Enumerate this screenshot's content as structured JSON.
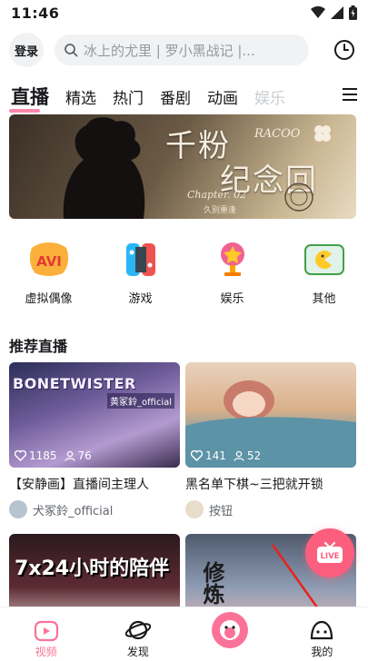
{
  "status": {
    "time": "11:46"
  },
  "header": {
    "login_label": "登录",
    "search_placeholder": "冰上的尤里 | 罗小黑战记 |..."
  },
  "tabs": [
    {
      "label": "直播",
      "active": true
    },
    {
      "label": "精选"
    },
    {
      "label": "热门"
    },
    {
      "label": "番剧"
    },
    {
      "label": "动画"
    },
    {
      "label": "娱乐"
    }
  ],
  "banner": {
    "title_line1": "千粉",
    "title_line2": "纪念回",
    "subtitle": "RACOO",
    "chapter": "Chapter. 02",
    "caption": "久别重逢"
  },
  "categories": [
    {
      "label": "虚拟偶像",
      "icon": "avi-icon"
    },
    {
      "label": "游戏",
      "icon": "game-console-icon"
    },
    {
      "label": "娱乐",
      "icon": "trophy-icon"
    },
    {
      "label": "其他",
      "icon": "tv-icon"
    }
  ],
  "section": {
    "title": "推荐直播"
  },
  "cards": [
    {
      "title": "【安静画】直播间主理人",
      "owner": "犬冢鈴_official",
      "likes": "1185",
      "viewers": "76",
      "cover_text": "BONETWISTER",
      "cover_tag": "黄冢鈴_official"
    },
    {
      "title": "黑名单下棋~三把就开锁",
      "owner": "按钮",
      "likes": "141",
      "viewers": "52"
    },
    {
      "cover_text": "7x24小时的陪伴"
    },
    {
      "cover_text": "修炼"
    }
  ],
  "live_fab": {
    "label": "LIVE"
  },
  "bottom_nav": [
    {
      "label": "视频",
      "active": true
    },
    {
      "label": "发现"
    },
    {
      "label": ""
    },
    {
      "label": "我的"
    }
  ],
  "colors": {
    "accent": "#fb7299",
    "live": "#fb5f7d"
  }
}
